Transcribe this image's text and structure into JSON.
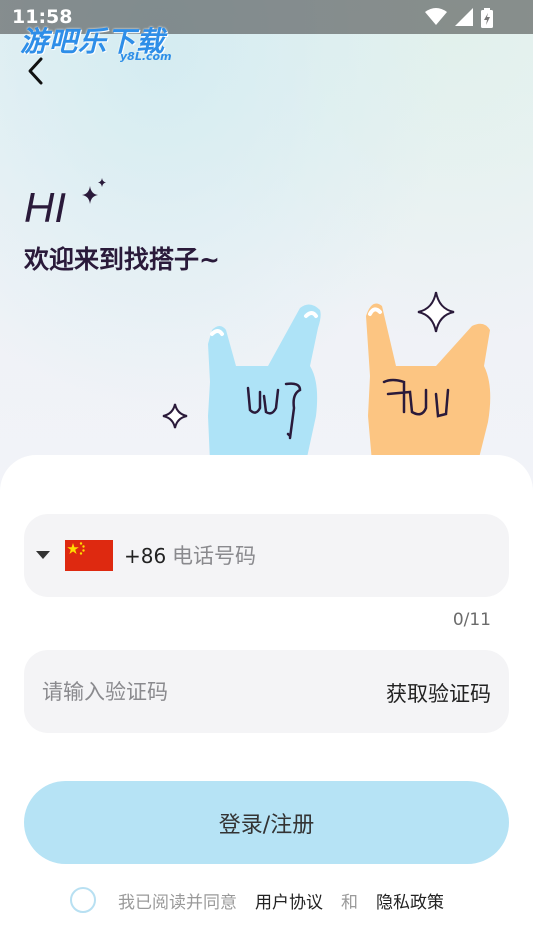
{
  "status_bar": {
    "time": "11:58"
  },
  "watermark": {
    "name": "游吧乐下载",
    "domain": "y8L.com"
  },
  "header": {
    "greeting": "HI",
    "welcome": "欢迎来到找搭子~"
  },
  "phone": {
    "dial_code": "+86",
    "placeholder": "电话号码",
    "counter": "0/11",
    "flag": "china-flag-icon"
  },
  "code": {
    "placeholder": "请输入验证码",
    "get_code_label": "获取验证码"
  },
  "login": {
    "label": "登录/注册"
  },
  "agreement": {
    "prefix": "我已阅读并同意",
    "user_agreement": "用户协议",
    "and": "和",
    "privacy_policy": "隐私政策"
  },
  "colors": {
    "primary_button": "#b6e3f5",
    "field_bg": "#f4f4f6",
    "hand_left": "#aee3f7",
    "hand_right": "#fcc582",
    "ink": "#2a1a3a"
  }
}
